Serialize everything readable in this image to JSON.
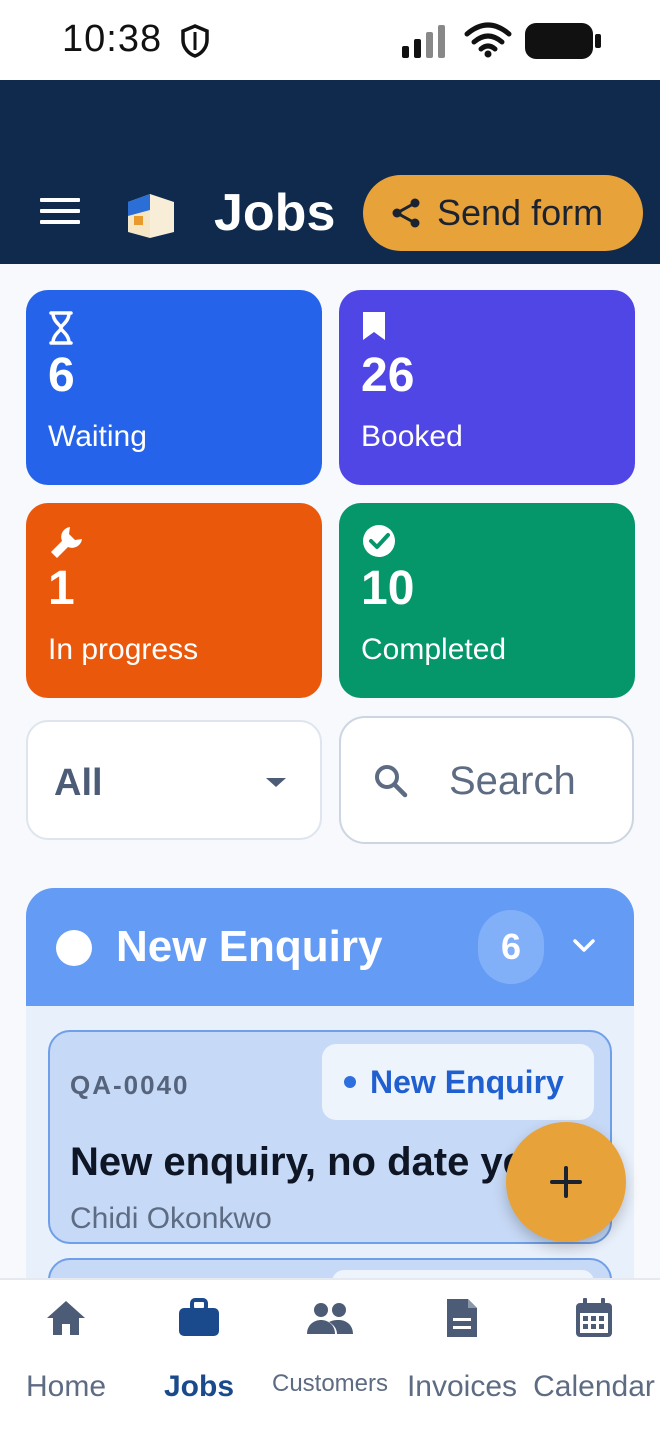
{
  "status_bar": {
    "time": "10:38"
  },
  "header": {
    "title": "Jobs",
    "send_form_label": "Send form"
  },
  "stats": [
    {
      "count": "6",
      "label": "Waiting",
      "icon": "hourglass-icon",
      "color": "#2563eb"
    },
    {
      "count": "26",
      "label": "Booked",
      "icon": "bookmark-icon",
      "color": "#4f46e5"
    },
    {
      "count": "1",
      "label": "In progress",
      "icon": "wrench-icon",
      "color": "#ea580c"
    },
    {
      "count": "10",
      "label": "Completed",
      "icon": "check-circle-icon",
      "color": "#059669"
    }
  ],
  "filter": {
    "selected": "All"
  },
  "search": {
    "placeholder": "Search"
  },
  "group": {
    "title": "New Enquiry",
    "count": "6",
    "color": "#649bf5"
  },
  "jobs": [
    {
      "ref": "QA-0040",
      "status": "New Enquiry",
      "title": "New enquiry, no date yet",
      "customer": "Chidi Okonkwo"
    }
  ],
  "nav": [
    {
      "label": "Home",
      "icon": "home-icon"
    },
    {
      "label": "Jobs",
      "icon": "briefcase-icon",
      "active": true
    },
    {
      "label": "Customers",
      "icon": "people-icon"
    },
    {
      "label": "Invoices",
      "icon": "document-icon"
    },
    {
      "label": "Calendar",
      "icon": "calendar-icon"
    }
  ],
  "colors": {
    "header_bg": "#0f2a4d",
    "accent": "#e8a23a",
    "nav_active": "#1b4a8c"
  }
}
